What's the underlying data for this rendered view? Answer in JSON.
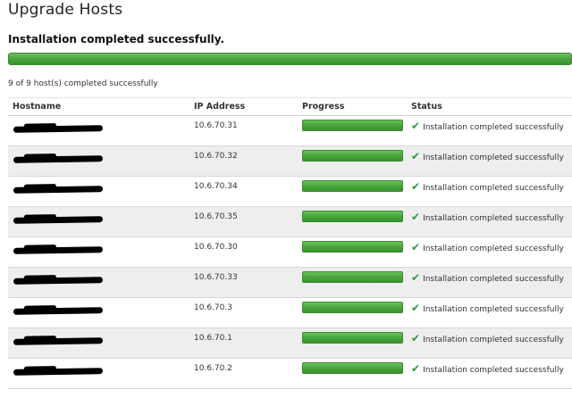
{
  "page": {
    "title": "Upgrade Hosts",
    "summary_heading": "Installation completed successfully.",
    "overall_progress": 1.0,
    "count_text": "9 of 9 host(s) completed successfully"
  },
  "table": {
    "headers": {
      "hostname": "Hostname",
      "ip": "IP Address",
      "progress": "Progress",
      "status": "Status"
    },
    "rows": [
      {
        "ip": "10.6.70.31",
        "progress": 1.0,
        "status": "Installation completed successfully"
      },
      {
        "ip": "10.6.70.32",
        "progress": 1.0,
        "status": "Installation completed successfully"
      },
      {
        "ip": "10.6.70.34",
        "progress": 1.0,
        "status": "Installation completed successfully"
      },
      {
        "ip": "10.6.70.35",
        "progress": 1.0,
        "status": "Installation completed successfully"
      },
      {
        "ip": "10.6.70.30",
        "progress": 1.0,
        "status": "Installation completed successfully"
      },
      {
        "ip": "10.6.70.33",
        "progress": 1.0,
        "status": "Installation completed successfully"
      },
      {
        "ip": "10.6.70.3",
        "progress": 1.0,
        "status": "Installation completed successfully"
      },
      {
        "ip": "10.6.70.1",
        "progress": 1.0,
        "status": "Installation completed successfully"
      },
      {
        "ip": "10.6.70.2",
        "progress": 1.0,
        "status": "Installation completed successfully"
      }
    ]
  },
  "colors": {
    "progress_fill": "#45a33a",
    "check": "#2d9a3e",
    "alt_row": "#eeeeee"
  },
  "icons": {
    "status": "check-icon",
    "hostname": "redacted-text"
  }
}
